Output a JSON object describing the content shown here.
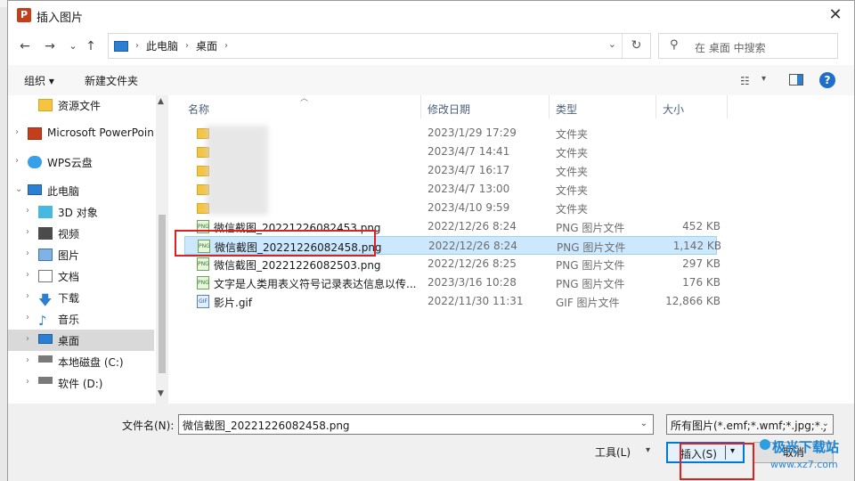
{
  "window": {
    "title": "插入图片",
    "app_icon_letter": "P",
    "close_glyph": "✕"
  },
  "nav": {
    "back": "←",
    "forward": "→",
    "recent": "⌄",
    "up": "↑"
  },
  "address": {
    "crumbs": [
      "此电脑",
      "桌面"
    ],
    "separator": "›",
    "refresh_glyph": "↻"
  },
  "search": {
    "placeholder": "在 桌面 中搜索"
  },
  "toolbar": {
    "organize": "组织 ▾",
    "new_folder": "新建文件夹",
    "view_glyph": "☷",
    "help": "?"
  },
  "navpane": {
    "items": [
      {
        "label": "资源文件",
        "icon": "folder-icon",
        "expander": ""
      },
      {
        "label": "Microsoft PowerPoin",
        "icon": "powerpoint-icon",
        "expander": "›"
      },
      {
        "label": "WPS云盘",
        "icon": "cloud-icon",
        "expander": "›"
      },
      {
        "label": "此电脑",
        "icon": "pc-icon",
        "expander": "⌄"
      },
      {
        "label": "3D 对象",
        "icon": "3d-objects-icon",
        "expander": "›"
      },
      {
        "label": "视频",
        "icon": "video-icon",
        "expander": "›"
      },
      {
        "label": "图片",
        "icon": "pictures-icon",
        "expander": "›"
      },
      {
        "label": "文档",
        "icon": "documents-icon",
        "expander": "›"
      },
      {
        "label": "下载",
        "icon": "downloads-icon",
        "expander": "›"
      },
      {
        "label": "音乐",
        "icon": "music-icon",
        "expander": "›"
      },
      {
        "label": "桌面",
        "icon": "desktop-icon",
        "expander": "›",
        "selected": true
      },
      {
        "label": "本地磁盘 (C:)",
        "icon": "drive-icon",
        "expander": "›"
      },
      {
        "label": "软件 (D:)",
        "icon": "drive-icon",
        "expander": "›"
      }
    ]
  },
  "columns": {
    "name": "名称",
    "date": "修改日期",
    "type": "类型",
    "size": "大小"
  },
  "files": [
    {
      "name": "",
      "date": "2023/1/29 17:29",
      "type": "文件夹",
      "size": "",
      "kind": "folder"
    },
    {
      "name": "",
      "date": "2023/4/7 14:41",
      "type": "文件夹",
      "size": "",
      "kind": "folder"
    },
    {
      "name": "",
      "date": "2023/4/7 16:17",
      "type": "文件夹",
      "size": "",
      "kind": "folder"
    },
    {
      "name": "",
      "date": "2023/4/7 13:00",
      "type": "文件夹",
      "size": "",
      "kind": "folder"
    },
    {
      "name": "",
      "date": "2023/4/10 9:59",
      "type": "文件夹",
      "size": "",
      "kind": "folder"
    },
    {
      "name": "微信截图_20221226082453.png",
      "date": "2022/12/26 8:24",
      "type": "PNG 图片文件",
      "size": "452 KB",
      "kind": "png"
    },
    {
      "name": "微信截图_20221226082458.png",
      "date": "2022/12/26 8:24",
      "type": "PNG 图片文件",
      "size": "1,142 KB",
      "kind": "png",
      "selected": true
    },
    {
      "name": "微信截图_20221226082503.png",
      "date": "2022/12/26 8:25",
      "type": "PNG 图片文件",
      "size": "297 KB",
      "kind": "png"
    },
    {
      "name": "文字是人类用表义符号记录表达信息以传...",
      "date": "2023/3/16 10:28",
      "type": "PNG 图片文件",
      "size": "176 KB",
      "kind": "png"
    },
    {
      "name": "影片.gif",
      "date": "2022/11/30 11:31",
      "type": "GIF 图片文件",
      "size": "12,866 KB",
      "kind": "gif"
    }
  ],
  "file_icon_text": {
    "png": "PNG",
    "gif": "GIF"
  },
  "bottom": {
    "filename_label": "文件名(N):",
    "filename_value": "微信截图_20221226082458.png",
    "filter_value": "所有图片(*.emf;*.wmf;*.jpg;*.j",
    "tools_label": "工具(L)",
    "insert_label": "插入(S)",
    "cancel_label": "取消",
    "caret": "⌄"
  },
  "watermark": {
    "title": "极光下载站",
    "url": "www.xz7.com"
  },
  "colors": {
    "highlight": "#e02020",
    "selection": "#cce8ff",
    "accent": "#0078d7"
  }
}
